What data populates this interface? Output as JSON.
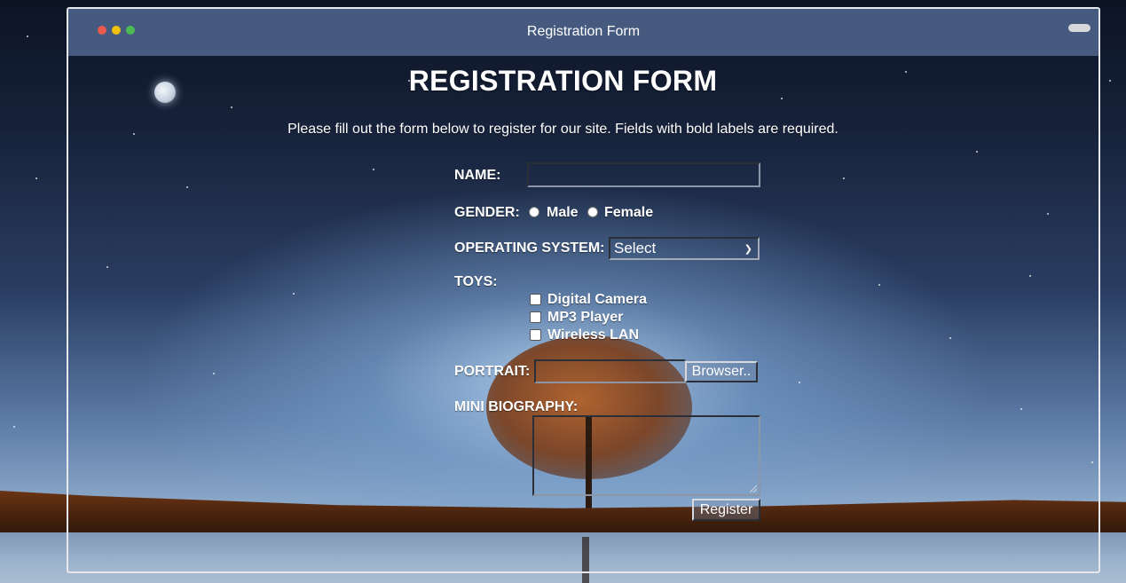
{
  "window": {
    "title": "Registration Form"
  },
  "form": {
    "heading": "REGISTRATION FORM",
    "intro": "Please fill out the form below to register for our site. Fields with bold labels are required.",
    "name": {
      "label": "NAME:",
      "value": ""
    },
    "gender": {
      "label": "GENDER:",
      "options": [
        "Male",
        "Female"
      ]
    },
    "os": {
      "label": "OPERATING SYSTEM:",
      "selected": "Select"
    },
    "toys": {
      "label": "TOYS:",
      "options": [
        "Digital Camera",
        "MP3 Player",
        "Wireless LAN"
      ]
    },
    "portrait": {
      "label": "PORTRAIT:",
      "button": "Browser.."
    },
    "bio": {
      "label": "MINI BIOGRAPHY:",
      "value": ""
    },
    "submit": "Register"
  },
  "colors": {
    "titlebar": "#455a7e",
    "window_border": "#e6e8ee"
  }
}
